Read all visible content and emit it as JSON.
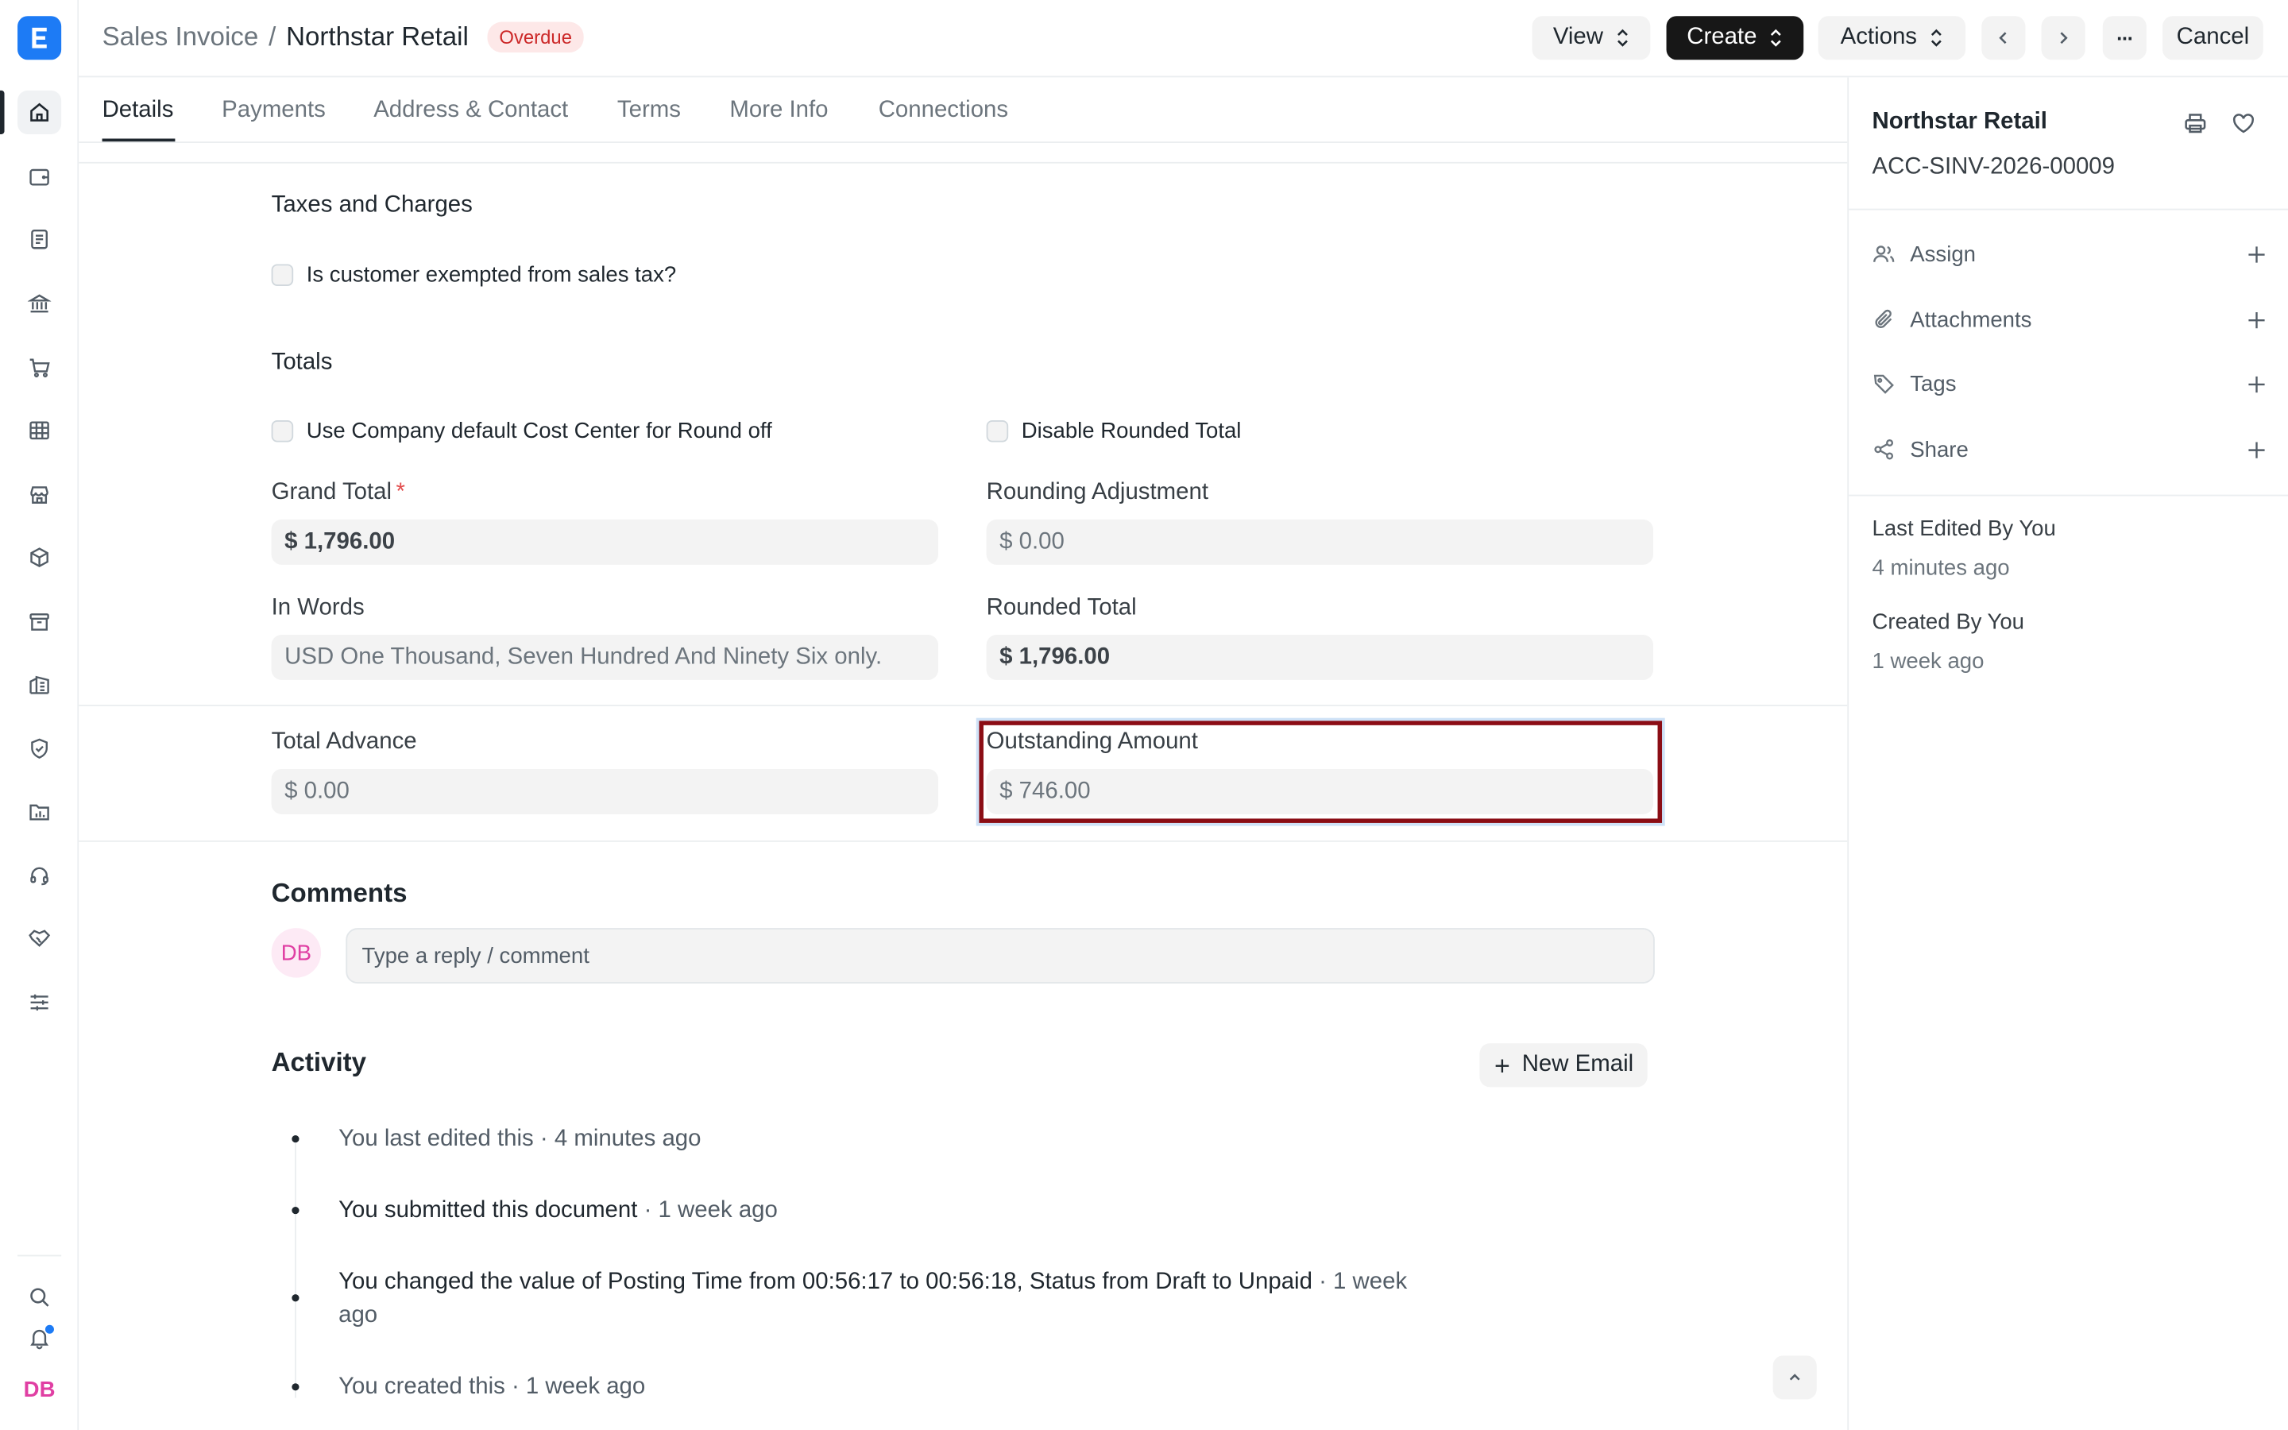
{
  "header": {
    "doctype": "Sales Invoice",
    "separator": "/",
    "title": "Northstar Retail",
    "status": "Overdue",
    "buttons": {
      "view": "View",
      "create": "Create",
      "actions": "Actions",
      "more": "···",
      "cancel": "Cancel"
    }
  },
  "tabs": [
    "Details",
    "Payments",
    "Address & Contact",
    "Terms",
    "More Info",
    "Connections"
  ],
  "taxes": {
    "title": "Taxes and Charges",
    "exempt_label": "Is customer exempted from sales tax?"
  },
  "totals": {
    "title": "Totals",
    "use_cost_center_label": "Use Company default Cost Center for Round off",
    "disable_rounded_label": "Disable Rounded Total",
    "grand_total_label": "Grand Total",
    "required_mark": "*",
    "grand_total_value": "$ 1,796.00",
    "rounding_adjustment_label": "Rounding Adjustment",
    "rounding_adjustment_value": "$ 0.00",
    "in_words_label": "In Words",
    "in_words_value": "USD One Thousand, Seven Hundred And Ninety Six only.",
    "rounded_total_label": "Rounded Total",
    "rounded_total_value": "$ 1,796.00"
  },
  "advance": {
    "total_advance_label": "Total Advance",
    "total_advance_value": "$ 0.00",
    "outstanding_label": "Outstanding Amount",
    "outstanding_value": "$ 746.00"
  },
  "comments": {
    "title": "Comments",
    "avatar": "DB",
    "placeholder": "Type a reply / comment"
  },
  "activity": {
    "title": "Activity",
    "new_email": "New Email",
    "items": [
      {
        "text": "You last edited this",
        "time": " · 4 minutes ago"
      },
      {
        "text": "You submitted this document",
        "time": " · 1 week ago"
      },
      {
        "p1": "You changed the value of Posting Time from ",
        "v1": "00:56:17",
        "p2": " to ",
        "v2": "00:56:18",
        "p3": ", Status from ",
        "v3": "Draft",
        "p4": " to ",
        "v4": "Unpaid",
        "time": " · 1 week ago"
      },
      {
        "text": "You created this",
        "time": " · 1 week ago"
      }
    ]
  },
  "sidebar": {
    "title": "Northstar Retail",
    "doc_id": "ACC-SINV-2026-00009",
    "items": [
      "Assign",
      "Attachments",
      "Tags",
      "Share"
    ],
    "last_edited_label": "Last Edited By You",
    "last_edited_time": "4 minutes ago",
    "created_label": "Created By You",
    "created_time": "1 week ago"
  },
  "rail": {
    "avatar": "DB"
  }
}
